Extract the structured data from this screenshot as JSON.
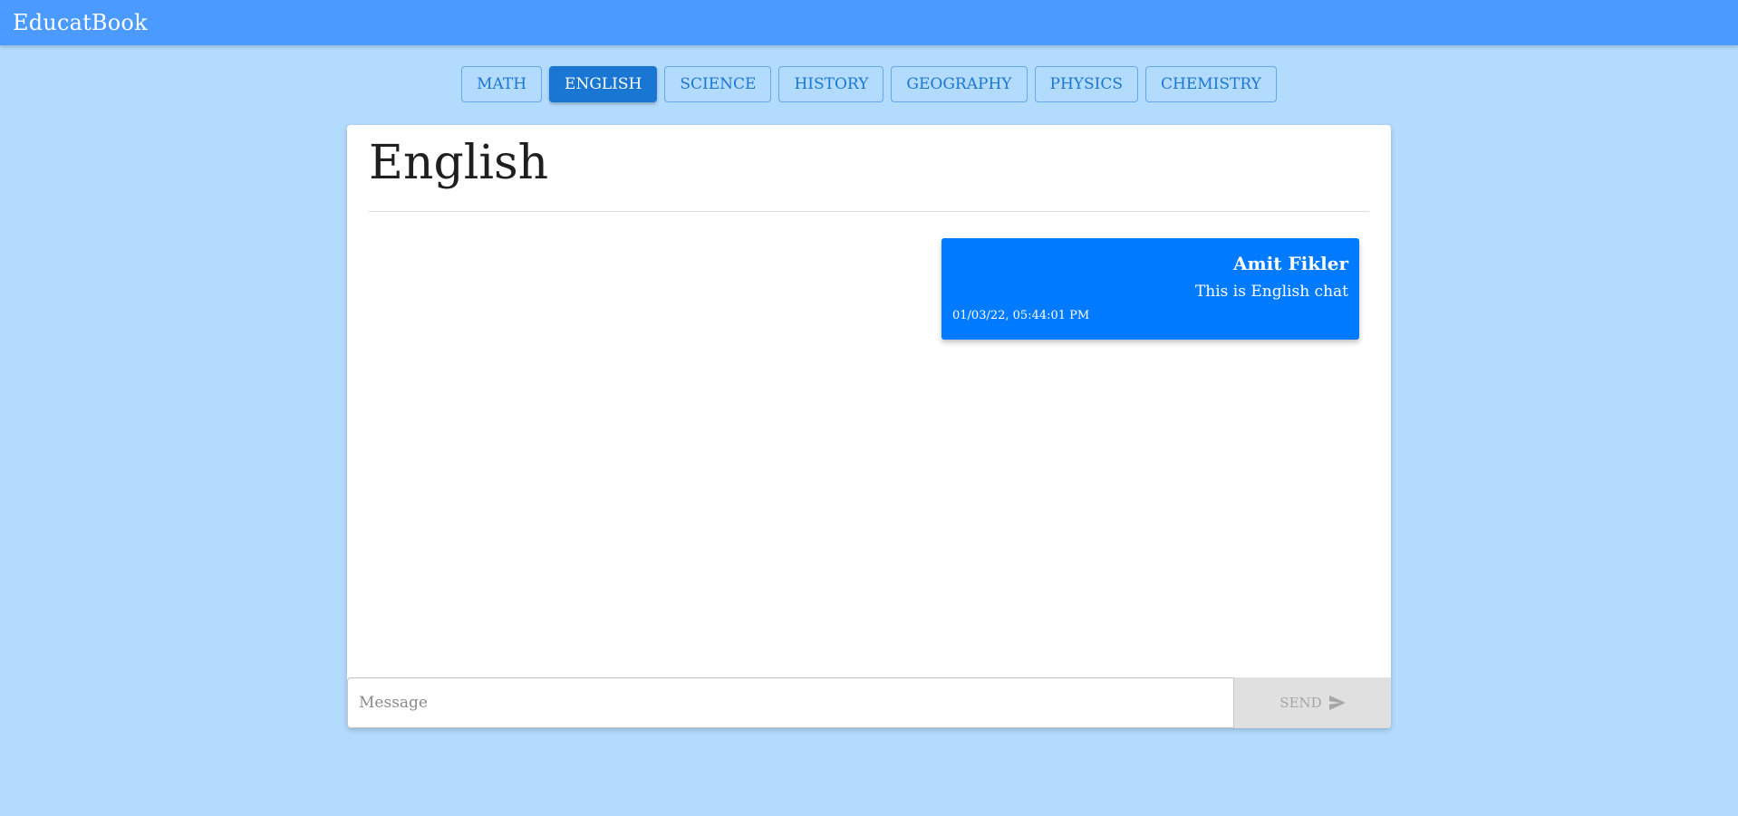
{
  "app": {
    "title": "EducatBook"
  },
  "tabs": [
    {
      "label": "MATH",
      "active": false
    },
    {
      "label": "ENGLISH",
      "active": true
    },
    {
      "label": "SCIENCE",
      "active": false
    },
    {
      "label": "HISTORY",
      "active": false
    },
    {
      "label": "GEOGRAPHY",
      "active": false
    },
    {
      "label": "PHYSICS",
      "active": false
    },
    {
      "label": "CHEMISTRY",
      "active": false
    }
  ],
  "chat": {
    "title": "English",
    "messages": [
      {
        "sender": "Amit Fikler",
        "text": "This is English chat",
        "timestamp": "01/03/22, 05:44:01 PM"
      }
    ]
  },
  "composer": {
    "placeholder": "Message",
    "value": "",
    "send_label": "SEND",
    "send_icon": "send-icon"
  },
  "colors": {
    "appbar": "#4a9aff",
    "background": "#b3dbfd",
    "tab_active": "#1976d2",
    "bubble": "#007bff",
    "send_disabled": "#e0e0e0"
  }
}
